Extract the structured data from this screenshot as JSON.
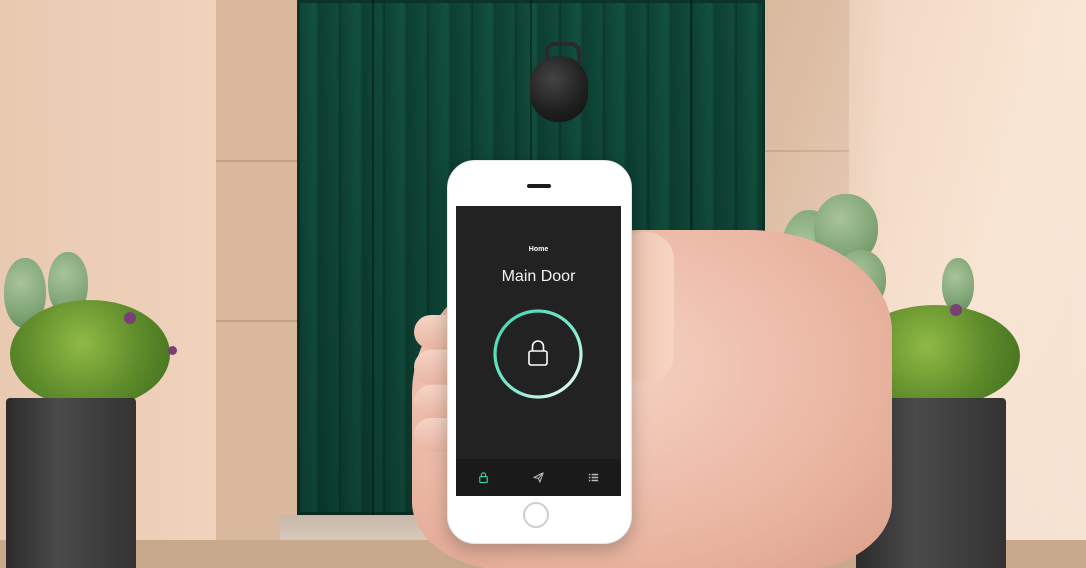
{
  "app": {
    "header_label": "Home",
    "lock_name": "Main Door",
    "lock_state": "locked",
    "tabs": [
      {
        "icon": "lock-icon",
        "active": true
      },
      {
        "icon": "send-icon",
        "active": false
      },
      {
        "icon": "list-icon",
        "active": false
      }
    ]
  },
  "colors": {
    "screen_bg": "#222222",
    "accent": "#3ed6b0",
    "inactive_icon": "#8a8a8a",
    "door_green": "#145a47"
  }
}
